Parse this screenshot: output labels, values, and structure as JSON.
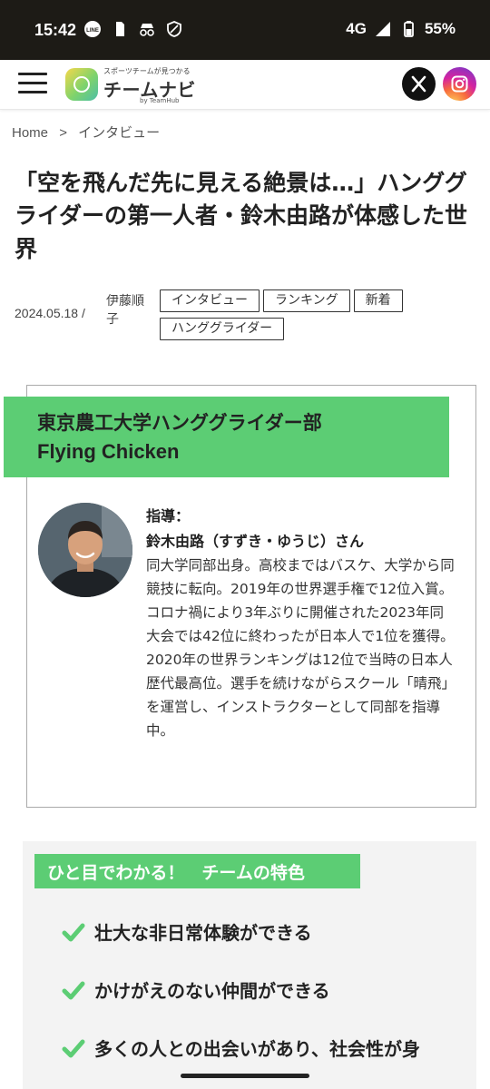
{
  "status_bar": {
    "time": "15:42",
    "network": "4G",
    "battery": "55%",
    "icons_left": [
      "line-icon",
      "sim-card-icon",
      "incognito-icon",
      "shield-icon"
    ],
    "icons_right": [
      "signal-icon",
      "battery-icon"
    ]
  },
  "header": {
    "logo_tagline": "スポーツチームが見つかる",
    "logo_name": "チームナビ",
    "logo_by": "by TeamHub",
    "social": [
      "x-icon",
      "instagram-icon"
    ]
  },
  "breadcrumb": {
    "home": "Home",
    "separator": ">",
    "current": "インタビュー"
  },
  "article": {
    "title": "「空を飛んだ先に見える絶景は…」ハンググライダーの第一人者・鈴木由路が体感した世界",
    "date": "2024.05.18 /",
    "author": "伊藤順子",
    "tags": [
      "インタビュー",
      "ランキング",
      "新着",
      "ハンググライダー"
    ]
  },
  "profile": {
    "team_line1": "東京農工大学ハンググライダー部",
    "team_line2": "Flying Chicken",
    "coach_label": "指導：",
    "coach_name": "鈴木由路（すずき・ゆうじ）さん",
    "bio": "同大学同部出身。高校まではバスケ、大学から同競技に転向。2019年の世界選手権で12位入賞。コロナ禍により3年ぶりに開催された2023年同大会では42位に終わったが日本人で1位を獲得。2020年の世界ランキングは12位で当時の日本人歴代最高位。選手を続けながらスクール「晴飛」を運営し、インストラクターとして同部を指導中。"
  },
  "features": {
    "heading": "ひと目でわかる！　チームの特色",
    "items": [
      "壮大な非日常体験ができる",
      "かけがえのない仲間ができる",
      "多くの人との出会いがあり、社会性が身"
    ]
  },
  "colors": {
    "accent_green": "#5ccd74",
    "status_bar": "#1d1b16",
    "feature_bg": "#f3f3f3"
  }
}
